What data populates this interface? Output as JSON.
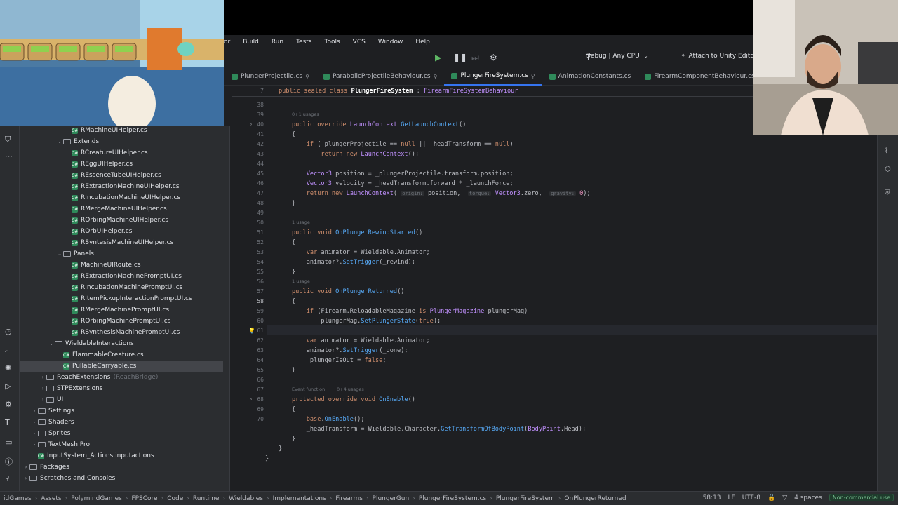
{
  "menu": [
    "Build",
    "Run",
    "Tests",
    "Tools",
    "VCS",
    "Window",
    "Help"
  ],
  "menu_partial_left": "or",
  "run_config": "Debug | Any CPU",
  "attach_label": "Attach to Unity Editor",
  "tabs": [
    {
      "label": "PlungerProjectile.cs",
      "pinned": true,
      "active": false
    },
    {
      "label": "ParabolicProjectileBehaviour.cs",
      "pinned": true,
      "active": false
    },
    {
      "label": "PlungerFireSystem.cs",
      "pinned": true,
      "active": true
    },
    {
      "label": "AnimationConstants.cs",
      "pinned": false,
      "active": false
    },
    {
      "label": "FirearmComponentBehaviour.cs",
      "pinned": false,
      "active": false
    }
  ],
  "tree": [
    {
      "label": "RMachineUIHelper.cs",
      "level": 5,
      "kind": "file"
    },
    {
      "label": "Extends",
      "level": 4,
      "kind": "folder"
    },
    {
      "label": "RCreatureUIHelper.cs",
      "level": 5,
      "kind": "file"
    },
    {
      "label": "REggUIHelper.cs",
      "level": 5,
      "kind": "file"
    },
    {
      "label": "REssenceTubeUIHelper.cs",
      "level": 5,
      "kind": "file"
    },
    {
      "label": "RExtractionMachineUIHelper.cs",
      "level": 5,
      "kind": "file"
    },
    {
      "label": "RIncubationMachineUIHelper.cs",
      "level": 5,
      "kind": "file"
    },
    {
      "label": "RMergeMachineUIHelper.cs",
      "level": 5,
      "kind": "file"
    },
    {
      "label": "ROrbingMachineUIHelper.cs",
      "level": 5,
      "kind": "file"
    },
    {
      "label": "ROrbUIHelper.cs",
      "level": 5,
      "kind": "file"
    },
    {
      "label": "RSyntesisMachineUIHelper.cs",
      "level": 5,
      "kind": "file"
    },
    {
      "label": "Panels",
      "level": 4,
      "kind": "folder"
    },
    {
      "label": "MachineUIRoute.cs",
      "level": 5,
      "kind": "file"
    },
    {
      "label": "RExtractionMachinePromptUI.cs",
      "level": 5,
      "kind": "file"
    },
    {
      "label": "RIncubationMachinePromptUI.cs",
      "level": 5,
      "kind": "file"
    },
    {
      "label": "RItemPickupInteractionPromptUI.cs",
      "level": 5,
      "kind": "file"
    },
    {
      "label": "RMergeMachinePromptUI.cs",
      "level": 5,
      "kind": "file"
    },
    {
      "label": "ROrbingMachinePromptUI.cs",
      "level": 5,
      "kind": "file"
    },
    {
      "label": "RSynthesisMachinePromptUI.cs",
      "level": 5,
      "kind": "file"
    },
    {
      "label": "WieldableInteractions",
      "level": 3,
      "kind": "folder"
    },
    {
      "label": "FlammableCreature.cs",
      "level": 4,
      "kind": "file"
    },
    {
      "label": "PullableCarryable.cs",
      "level": 4,
      "kind": "file",
      "selected": true
    },
    {
      "label": "ReachExtensions",
      "level": 2,
      "kind": "folder-closed",
      "note": "(ReachBridge)"
    },
    {
      "label": "STPExtensions",
      "level": 2,
      "kind": "folder-closed"
    },
    {
      "label": "UI",
      "level": 2,
      "kind": "folder-closed"
    },
    {
      "label": "Settings",
      "level": 1,
      "kind": "folder-closed"
    },
    {
      "label": "Shaders",
      "level": 1,
      "kind": "folder-closed"
    },
    {
      "label": "Sprites",
      "level": 1,
      "kind": "folder-closed"
    },
    {
      "label": "TextMesh Pro",
      "level": 1,
      "kind": "folder-closed"
    },
    {
      "label": "InputSystem_Actions.inputactions",
      "level": 1,
      "kind": "file"
    },
    {
      "label": "Packages",
      "level": 0,
      "kind": "folder-closed"
    },
    {
      "label": "Scratches and Consoles",
      "level": 0,
      "kind": "folder-closed"
    }
  ],
  "sticky": {
    "line": "7",
    "text": "public sealed class PlungerFireSystem : FirearmFireSystemBehaviour"
  },
  "usages": {
    "u1": "0+1 usages",
    "u2": "1 usage",
    "u3": "1 usage",
    "u4_event": "Event function",
    "u4": "0+4 usages"
  },
  "hints": {
    "origin": "origin:",
    "torque": "torque:",
    "gravity": "gravity:"
  },
  "line_numbers": [
    "38",
    "39",
    "40",
    "41",
    "42",
    "43",
    "44",
    "45",
    "46",
    "47",
    "48",
    "49",
    "50",
    "51",
    "52",
    "53",
    "54",
    "55",
    "56",
    "57",
    "58",
    "59",
    "60",
    "61",
    "62",
    "63",
    "64",
    "65",
    "66",
    "67",
    "68",
    "69",
    "70"
  ],
  "status": {
    "breadcrumbs": [
      "idGames",
      "Assets",
      "PolymindGames",
      "FPSCore",
      "Code",
      "Runtime",
      "Wieldables",
      "Implementations",
      "Firearms",
      "PlungerGun",
      "PlungerFireSystem.cs",
      "PlungerFireSystem",
      "OnPlungerReturned"
    ],
    "position": "58:13",
    "line_ending": "LF",
    "encoding": "UTF-8",
    "indent": "4 spaces",
    "license": "Non-commercial use"
  },
  "colors": {
    "accent": "#3574f0",
    "bg": "#1e1f22",
    "panel": "#2b2d30"
  }
}
